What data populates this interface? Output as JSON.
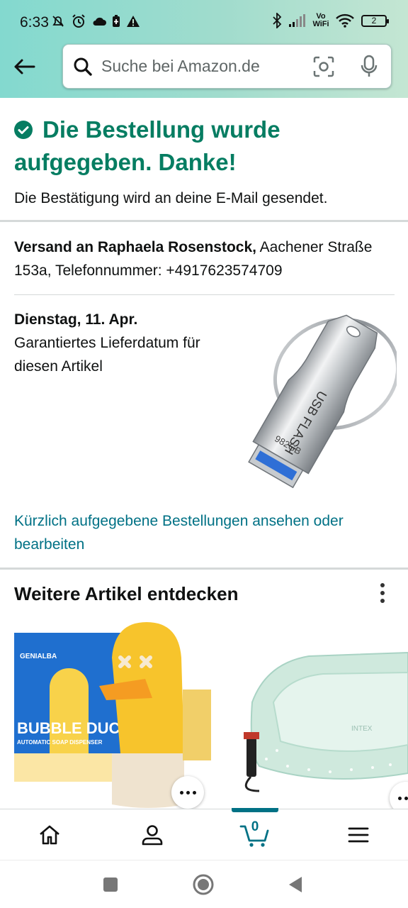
{
  "status_bar": {
    "time": "6:33",
    "volte_label": "Vo WiFi",
    "battery_level": "2"
  },
  "search": {
    "placeholder": "Suche bei Amazon.de"
  },
  "confirmation": {
    "title": "Die Bestellung wurde aufgegeben. Danke!",
    "subtitle": "Die Bestätigung wird an deine E-Mail gesendet."
  },
  "shipping": {
    "prefix": "Versand an Raphaela Rosenstock,",
    "address": "Aachener Straße 153a, Telefonnummer: +4917623574709"
  },
  "delivery": {
    "date": "Dienstag, 11. Apr.",
    "note": "Garantiertes Lieferdatum für diesen Artikel"
  },
  "product": {
    "print_main": "USB FLASH",
    "print_capacity": "982GB"
  },
  "orders_link": "Kürzlich aufgegebene Bestellungen ansehen oder bearbeiten",
  "recommendations": {
    "title": "Weitere Artikel entdecken",
    "item1": {
      "brand": "GENIALBA",
      "name": "BUBBLE DUCK",
      "subtitle": "AUTOMATIC SOAP DISPENSER"
    },
    "item2": {
      "brand": "INTEX"
    }
  },
  "bottom_nav": {
    "cart_count": "0"
  },
  "colors": {
    "accent_green": "#067d62",
    "link_teal": "#007185",
    "header_gradient_start": "#83d9cf",
    "header_gradient_end": "#c4e6d3"
  }
}
